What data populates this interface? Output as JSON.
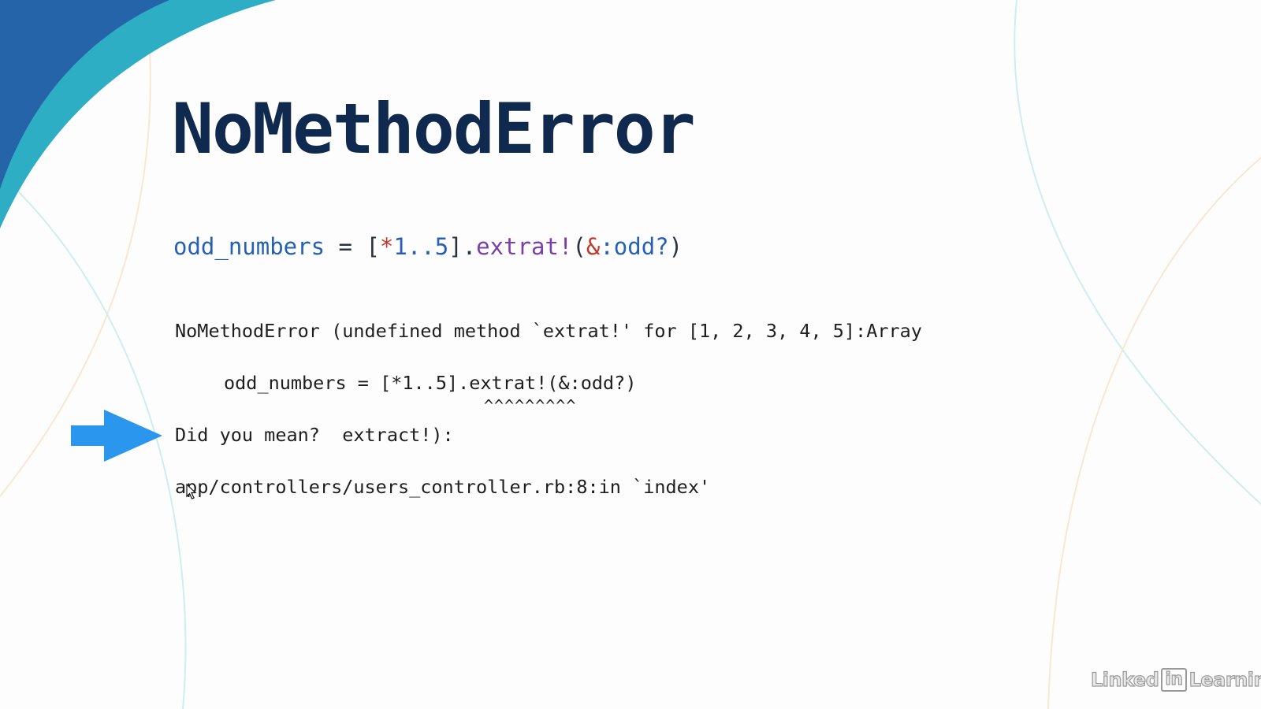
{
  "slide": {
    "title": "NoMethodError",
    "code": {
      "var": "odd_numbers",
      "assign": " = ",
      "open_bracket": "[",
      "splat": "*",
      "range": "1..5",
      "close_dot": "].",
      "method": "extrat!",
      "paren_open": "(",
      "amp": "&",
      "symbol": ":odd?",
      "paren_close": ")"
    },
    "error": {
      "header": "NoMethodError (undefined method `extrat!' for [1, 2, 3, 4, 5]:Array",
      "snippet": "odd_numbers = [*1..5].extrat!(&:odd?)",
      "carets": "^^^^^^^^^",
      "did_you_mean": "Did you mean?  extract!):",
      "trace": "app/controllers/users_controller.rb:8:in `index'"
    },
    "pointer_icon": "arrow-right-icon",
    "accent_color": "#2b96ee"
  },
  "branding": {
    "name_left": "Linked",
    "name_box": "in",
    "name_right": "Learning"
  },
  "colors": {
    "title": "#0f2a4e",
    "corner_dark": "#2564a8",
    "corner_teal": "#2eaec4",
    "arrow": "#2b96ee"
  }
}
